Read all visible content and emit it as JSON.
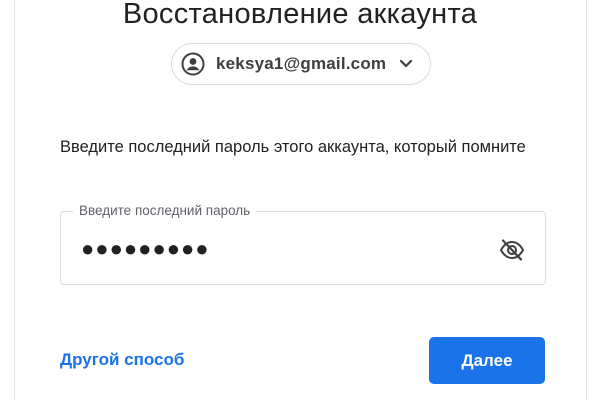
{
  "header": {
    "title": "Восстановление аккаунта"
  },
  "account": {
    "email": "keksya1@gmail.com",
    "avatar_icon": "account-circle-icon",
    "chevron_icon": "chevron-down-icon"
  },
  "form": {
    "prompt": "Введите последний пароль этого аккаунта, который помните",
    "password_label": "Введите последний пароль",
    "password_value": "●●●●●●●●●",
    "visibility_icon": "eye-off-icon"
  },
  "actions": {
    "other_way_label": "Другой способ",
    "next_label": "Далее"
  },
  "colors": {
    "accent": "#1a73e8",
    "text": "#202124",
    "border": "#dadce0"
  }
}
